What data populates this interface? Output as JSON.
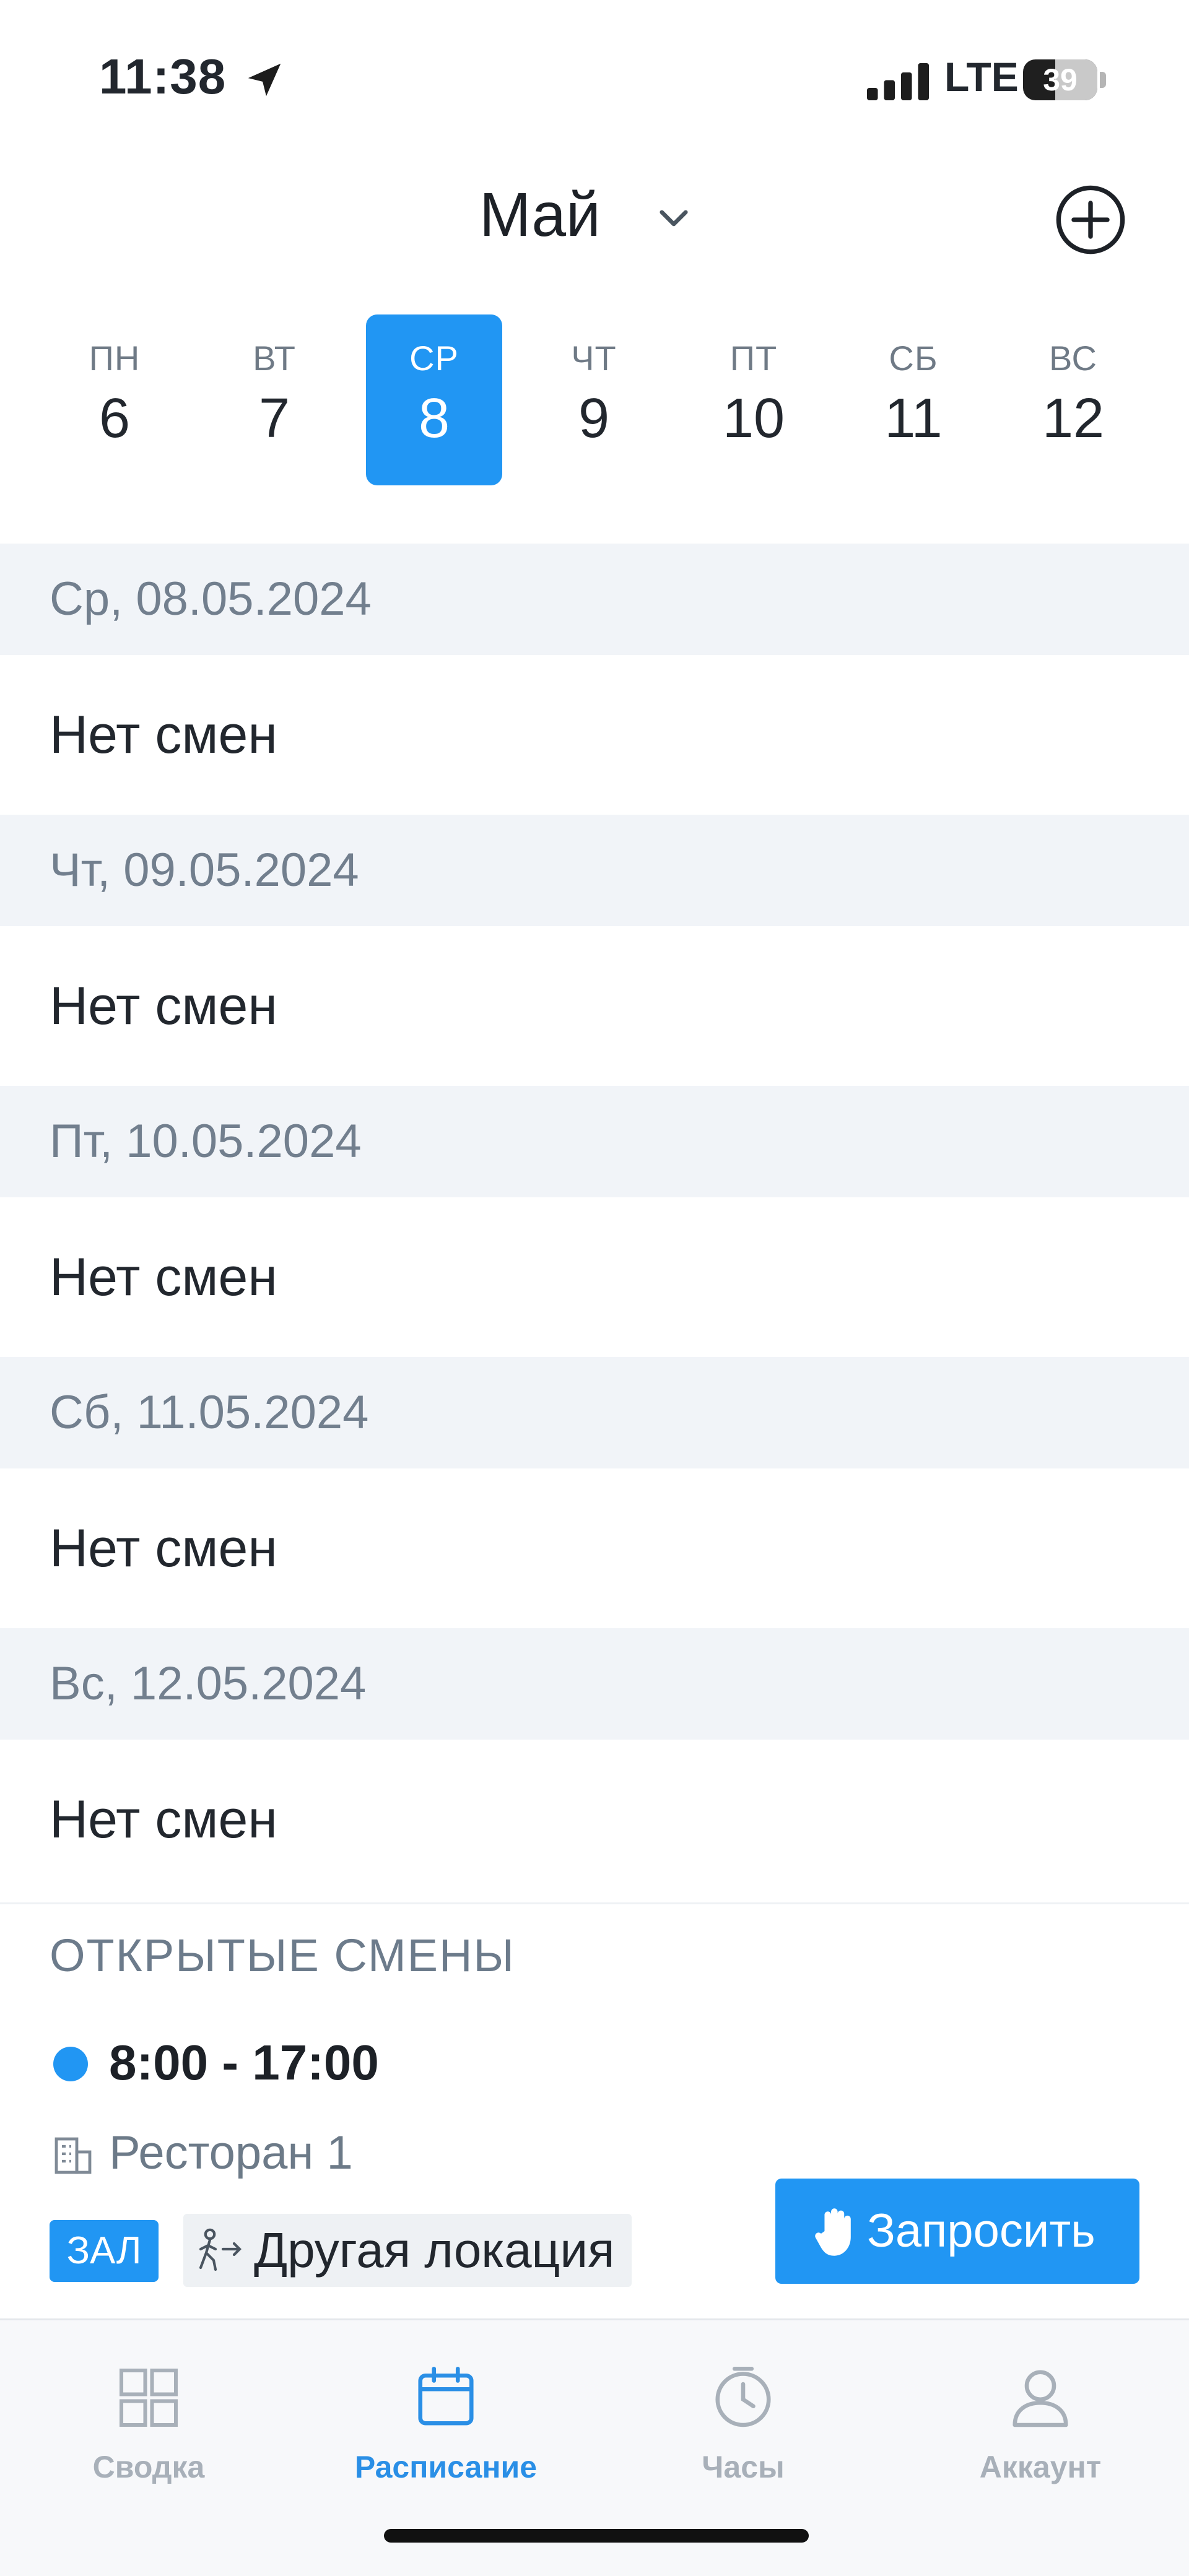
{
  "status_bar": {
    "time": "11:38",
    "network": "LTE",
    "battery": "39",
    "icons": [
      "location-arrow-icon",
      "signal-bars-icon",
      "battery-icon"
    ]
  },
  "header": {
    "month": "Май",
    "month_picker_icon": "chevron-down-icon",
    "add_icon": "plus-circle-icon"
  },
  "week": {
    "days": [
      {
        "name": "ПН",
        "num": "6"
      },
      {
        "name": "ВТ",
        "num": "7"
      },
      {
        "name": "СР",
        "num": "8"
      },
      {
        "name": "ЧТ",
        "num": "9"
      },
      {
        "name": "ПТ",
        "num": "10"
      },
      {
        "name": "СБ",
        "num": "11"
      },
      {
        "name": "ВС",
        "num": "12"
      }
    ],
    "selected_index": 2
  },
  "schedule": [
    {
      "date": "Ср, 08.05.2024",
      "text": "Нет смен"
    },
    {
      "date": "Чт, 09.05.2024",
      "text": "Нет смен"
    },
    {
      "date": "Пт, 10.05.2024",
      "text": "Нет смен"
    },
    {
      "date": "Сб, 11.05.2024",
      "text": "Нет смен"
    },
    {
      "date": "Вс, 12.05.2024",
      "text": "Нет смен"
    }
  ],
  "open_shifts": {
    "title": "ОТКРЫТЫЕ СМЕНЫ",
    "shift": {
      "time": "8:00 - 17:00",
      "restaurant": "Ресторан 1",
      "badge": "ЗАЛ",
      "location": "Другая локация",
      "request_label": "Запросить"
    }
  },
  "tabs": [
    {
      "label": "Сводка",
      "icon": "dashboard-grid-icon"
    },
    {
      "label": "Расписание",
      "icon": "calendar-icon"
    },
    {
      "label": "Часы",
      "icon": "clock-icon"
    },
    {
      "label": "Аккаунт",
      "icon": "user-icon"
    }
  ],
  "active_tab": 1,
  "colors": {
    "accent": "#2196f3",
    "section_bg": "#f1f4f8",
    "muted_text": "#727f8e",
    "tab_inactive": "#a8b0b9"
  }
}
